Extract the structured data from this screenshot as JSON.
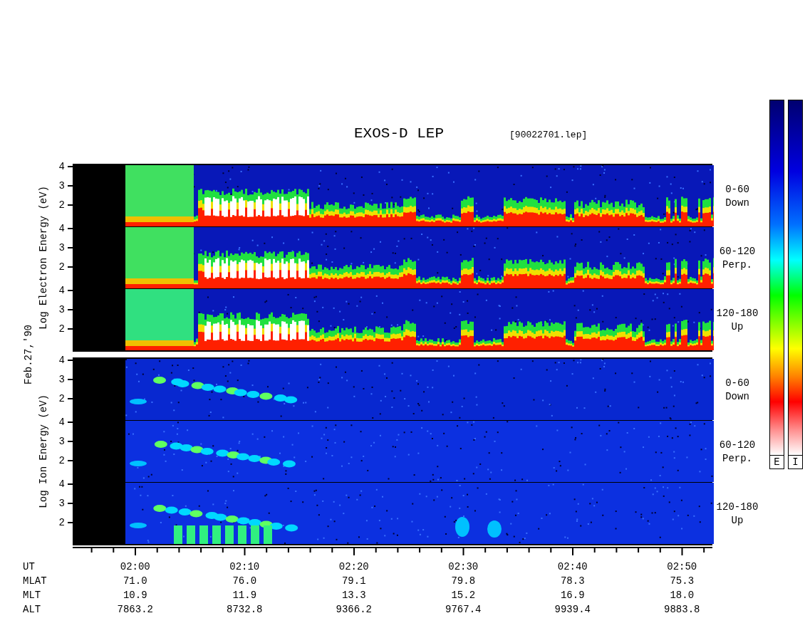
{
  "title": "EXOS-D LEP",
  "file_name": "[90022701.lep]",
  "date_label": "Feb.27,'90",
  "groups": [
    {
      "kind": "electron",
      "axis_label": "Log Electron Energy (eV)",
      "panels": [
        {
          "yticks": [
            "4",
            "3",
            "2"
          ],
          "angle": "0-60",
          "direction": "Down"
        },
        {
          "yticks": [
            "4",
            "3",
            "2"
          ],
          "angle": "60-120",
          "direction": "Perp."
        },
        {
          "yticks": [
            "4",
            "3",
            "2"
          ],
          "angle": "120-180",
          "direction": "Up"
        }
      ]
    },
    {
      "kind": "ion",
      "axis_label": "Log Ion Energy (eV)",
      "panels": [
        {
          "yticks": [
            "4",
            "3",
            "2"
          ],
          "angle": "0-60",
          "direction": "Down"
        },
        {
          "yticks": [
            "4",
            "3",
            "2"
          ],
          "angle": "60-120",
          "direction": "Perp."
        },
        {
          "yticks": [
            "4",
            "3",
            "2"
          ],
          "angle": "120-180",
          "direction": "Up"
        }
      ]
    }
  ],
  "table": [
    {
      "label": "UT",
      "values": [
        "02:00",
        "02:10",
        "02:20",
        "02:30",
        "02:40",
        "02:50"
      ]
    },
    {
      "label": "MLAT",
      "values": [
        "71.0",
        "76.0",
        "79.1",
        "79.8",
        "78.3",
        "75.3"
      ]
    },
    {
      "label": "MLT",
      "values": [
        "10.9",
        "11.9",
        "13.3",
        "15.2",
        "16.9",
        "18.0"
      ]
    },
    {
      "label": "ALT",
      "values": [
        "7863.2",
        "8732.8",
        "9366.2",
        "9767.4",
        "9939.4",
        "9883.8"
      ]
    }
  ],
  "color_scales": [
    {
      "label": "E"
    },
    {
      "label": "I"
    }
  ]
}
